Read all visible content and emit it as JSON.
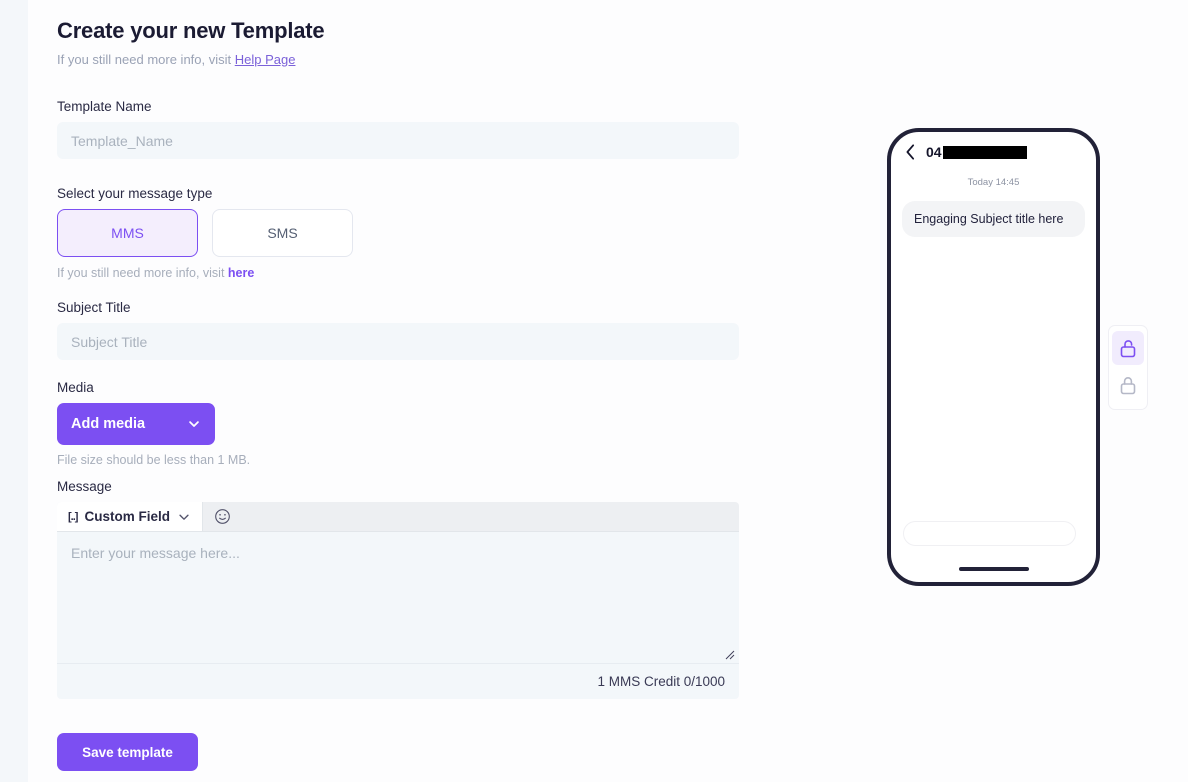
{
  "header": {
    "title": "Create your new Template",
    "subtitle_prefix": "If you still need more info, visit ",
    "subtitle_link": "Help Page"
  },
  "template_name": {
    "label": "Template Name",
    "placeholder": "Template_Name",
    "value": ""
  },
  "message_type": {
    "label": "Select your message type",
    "options": [
      {
        "label": "MMS",
        "selected": true
      },
      {
        "label": "SMS",
        "selected": false
      }
    ],
    "helper_prefix": "If you still need more info, visit ",
    "helper_link": "here"
  },
  "subject": {
    "label": "Subject Title",
    "placeholder": "Subject Title",
    "value": ""
  },
  "media": {
    "label": "Media",
    "button_label": "Add media",
    "note": "File size should be less than 1 MB."
  },
  "message": {
    "label": "Message",
    "custom_field_label": "Custom Field",
    "custom_field_bracket": "[..]",
    "placeholder": "Enter your message here...",
    "value": "",
    "credit_text": "1 MMS Credit 0/1000"
  },
  "actions": {
    "save_label": "Save template"
  },
  "preview": {
    "phone_number_prefix": "04",
    "timestamp": "Today 14:45",
    "bubble_text": "Engaging Subject title here"
  },
  "lock_panel": {
    "items": [
      {
        "name": "unlocked",
        "active": true
      },
      {
        "name": "locked",
        "active": false
      }
    ]
  },
  "colors": {
    "accent": "#7c4ff2",
    "accent_soft": "#f4eefd",
    "input_bg": "#f3f7fa",
    "text": "#2a2a44",
    "muted": "#a7aebb"
  }
}
